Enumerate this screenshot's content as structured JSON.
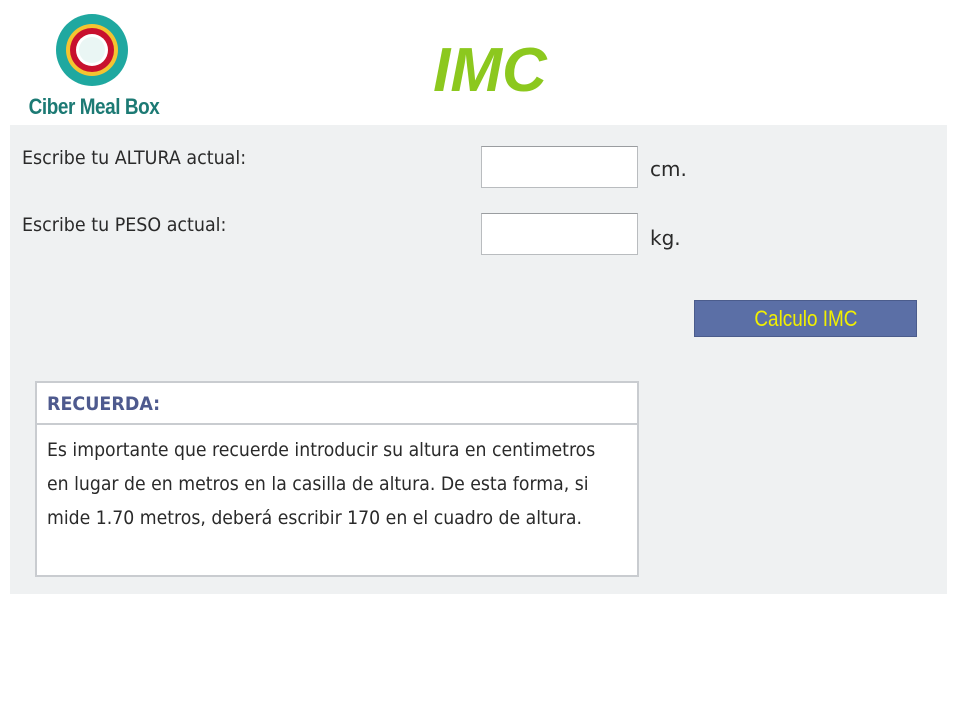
{
  "logo": {
    "text": "Ciber Meal Box",
    "icon": "concentric-rings-logo-icon",
    "colors": {
      "outer": "#1fa8a0",
      "middle": "#f4c430",
      "inner": "#c8102e",
      "text": "#1c7a74"
    }
  },
  "title": "IMC",
  "form": {
    "height_label": "Escribe tu ALTURA actual:",
    "height_value": "",
    "height_unit": "cm.",
    "weight_label": "Escribe tu PESO actual:",
    "weight_value": "",
    "weight_unit": "kg.",
    "calc_button": "Calculo IMC"
  },
  "note": {
    "header": "RECUERDA:",
    "lines": [
      "Es importante que recuerde introducir su altura en centimetros",
      "en lugar de en metros en la casilla de altura. De esta forma, si",
      "mide 1.70 metros, deberá escribir 170 en el cuadro de altura."
    ]
  },
  "colors": {
    "title": "#8cc81e",
    "panel": "#eff1f2",
    "button_bg": "#5b6fa6",
    "button_text": "#f2f000",
    "note_header": "#4e5a8e"
  }
}
